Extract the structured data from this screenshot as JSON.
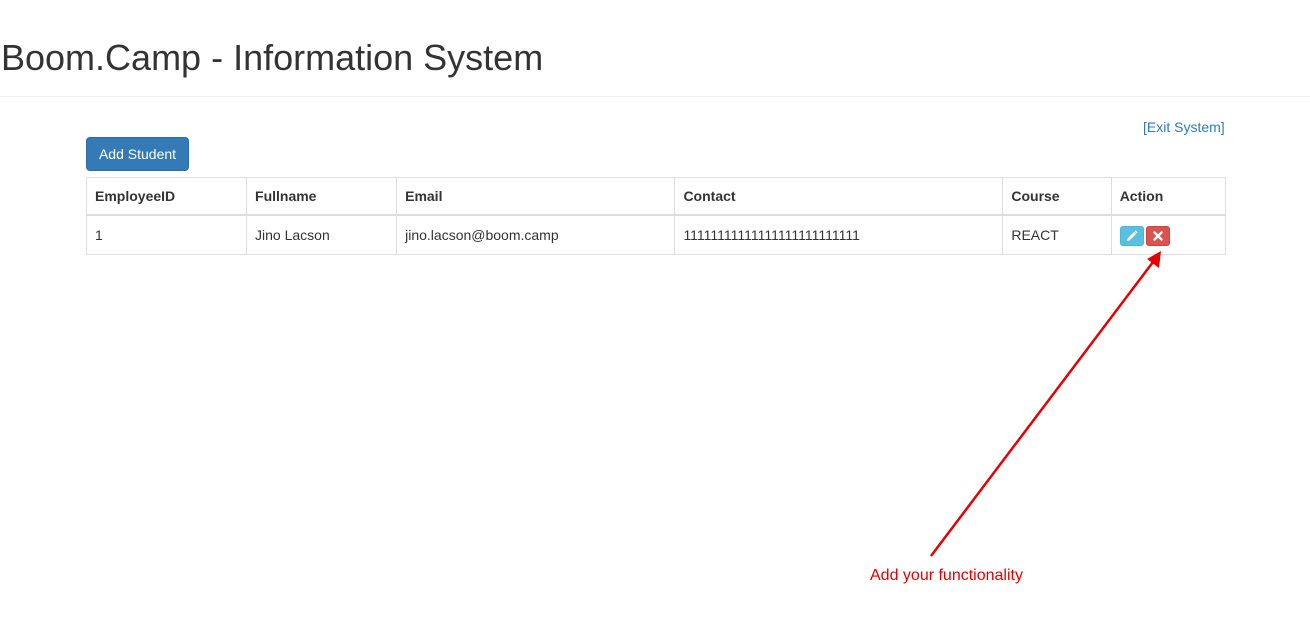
{
  "header": {
    "title": "Boom.Camp - Information System"
  },
  "toolbar": {
    "exit_label": "[Exit System]",
    "add_label": "Add Student"
  },
  "table": {
    "columns": [
      "EmployeeID",
      "Fullname",
      "Email",
      "Contact",
      "Course",
      "Action"
    ],
    "rows": [
      {
        "id": "1",
        "fullname": "Jino Lacson",
        "email": "jino.lacson@boom.camp",
        "contact": "11111111111111111111111111",
        "course": "REACT",
        "actions": [
          "pencil-icon",
          "times-icon"
        ]
      }
    ]
  },
  "annotation": {
    "text": "Add your functionality",
    "color": "#e60000"
  },
  "colors": {
    "primary": "#337ab7",
    "info": "#5bc0de",
    "danger": "#d9534f"
  }
}
